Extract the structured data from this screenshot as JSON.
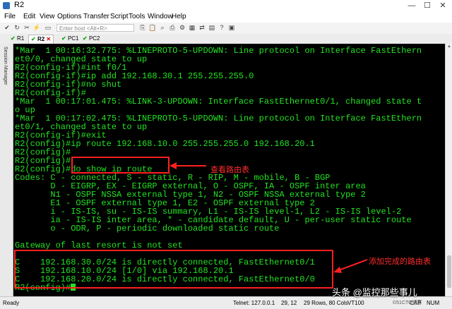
{
  "window": {
    "title": "R2",
    "minimize": "—",
    "maximize": "☐",
    "close": "✕"
  },
  "menu": [
    "File",
    "Edit",
    "View",
    "Options",
    "Transfer",
    "Script",
    "Tools",
    "Window",
    "Help"
  ],
  "toolbar": {
    "host_placeholder": "Enter host <Alt+R>"
  },
  "tabs": [
    {
      "label": "R1",
      "status": "✔"
    },
    {
      "label": "R2",
      "status": "✔",
      "close": "✕"
    },
    {
      "label": "PC1",
      "status": "✔"
    },
    {
      "label": "PC2",
      "status": "✔"
    }
  ],
  "side_panel": {
    "label": "Session Manager"
  },
  "terminal": {
    "lines": [
      "*Mar  1 00:16:32.775: %LINEPROTO-5-UPDOWN: Line protocol on Interface FastEthern",
      "et0/0, changed state to up",
      "R2(config-if)#int f0/1",
      "R2(config-if)#ip add 192.168.30.1 255.255.255.0",
      "R2(config-if)#no shut",
      "R2(config-if)#",
      "*Mar  1 00:17:01.475: %LINK-3-UPDOWN: Interface FastEthernet0/1, changed state t",
      "o up",
      "*Mar  1 00:17:02.475: %LINEPROTO-5-UPDOWN: Line protocol on Interface FastEthern",
      "et0/1, changed state to up",
      "R2(config-if)#exit",
      "R2(config)#ip route 192.168.10.0 255.255.255.0 192.168.20.1",
      "R2(config)#",
      "R2(config)#",
      "R2(config)#do show ip route",
      "Codes: C - connected, S - static, R - RIP, M - mobile, B - BGP",
      "       D - EIGRP, EX - EIGRP external, O - OSPF, IA - OSPF inter area",
      "       N1 - OSPF NSSA external type 1, N2 - OSPF NSSA external type 2",
      "       E1 - OSPF external type 1, E2 - OSPF external type 2",
      "       i - IS-IS, su - IS-IS summary, L1 - IS-IS level-1, L2 - IS-IS level-2",
      "       ia - IS-IS inter area, * - candidate default, U - per-user static route",
      "       o - ODR, P - periodic downloaded static route",
      "",
      "Gateway of last resort is not set",
      "",
      "C    192.168.30.0/24 is directly connected, FastEthernet0/1",
      "S    192.168.10.0/24 [1/0] via 192.168.20.1",
      "C    192.168.20.0/24 is directly connected, FastEthernet0/0",
      "R2(config)#"
    ]
  },
  "annotations": {
    "show_route": "查看路由表",
    "added_routes": "添加完成的路由表"
  },
  "statusbar": {
    "ready": "Ready",
    "connection": "Telnet: 127.0.0.1",
    "position": "29, 12",
    "size": "29 Rows, 80 Cols",
    "emulation": "VT100",
    "caps": "CAP",
    "num": "NUM"
  },
  "watermark": "头条 @监控那些事儿",
  "watermark2": "©51CTO博客",
  "colors": {
    "terminal_bg": "#000000",
    "terminal_fg": "#22e322",
    "annotation": "#ff2020"
  }
}
